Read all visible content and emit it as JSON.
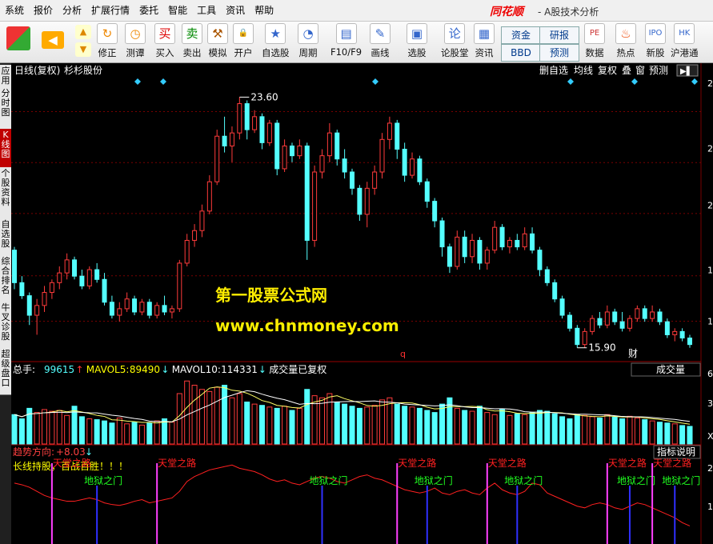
{
  "menu": [
    "系统",
    "报价",
    "分析",
    "扩展行情",
    "委托",
    "智能",
    "工具",
    "资讯",
    "帮助"
  ],
  "brand": "同花顺",
  "app_title": "- A股技术分析",
  "toolbar": {
    "items": [
      {
        "label": "修正",
        "icon": "refresh-icon",
        "x": 121
      },
      {
        "label": "测谭",
        "icon": "clock-icon",
        "x": 156
      },
      {
        "label": "买入",
        "icon": "buy-icon",
        "x": 193
      },
      {
        "label": "卖出",
        "icon": "sell-icon",
        "x": 227
      },
      {
        "label": "模拟",
        "icon": "gavel-icon",
        "x": 259
      },
      {
        "label": "开户",
        "icon": "lock-icon",
        "x": 291
      },
      {
        "label": "自选股",
        "icon": "star-icon",
        "x": 327
      },
      {
        "label": "周期",
        "icon": "clock-period-icon",
        "x": 372
      },
      {
        "label": "F10/F9",
        "icon": "f10-icon",
        "x": 413
      },
      {
        "label": "画线",
        "icon": "pencil-icon",
        "x": 462
      },
      {
        "label": "选股",
        "icon": "monitor-icon",
        "x": 508
      },
      {
        "label": "论股堂",
        "icon": "forum-icon",
        "x": 551
      },
      {
        "label": "资讯",
        "icon": "news-icon",
        "x": 592
      },
      {
        "label": "数据",
        "icon": "pe-icon",
        "x": 730
      },
      {
        "label": "热点",
        "icon": "fire-icon",
        "x": 769
      },
      {
        "label": "新股",
        "icon": "ipo-icon",
        "x": 806
      },
      {
        "label": "沪港通",
        "icon": "hk-icon",
        "x": 838
      }
    ],
    "boxes": [
      {
        "label": "资金",
        "x": 626,
        "y": 33
      },
      {
        "label": "BBD",
        "x": 626,
        "y": 55
      },
      {
        "label": "研报",
        "x": 674,
        "y": 33
      },
      {
        "label": "预测",
        "x": 674,
        "y": 55
      }
    ]
  },
  "side_tabs": [
    {
      "label": "应用",
      "active": false
    },
    {
      "label": "分时图",
      "active": false
    },
    {
      "label": "K线图",
      "active": true
    },
    {
      "label": "个股资料",
      "active": false
    },
    {
      "label": "自选股",
      "active": false
    },
    {
      "label": "综合排名",
      "active": false
    },
    {
      "label": "牛叉诊股",
      "active": false
    },
    {
      "label": "超级盘口",
      "active": false
    }
  ],
  "kline": {
    "period_label": "日线(复权)",
    "stock_name": "杉杉股份",
    "toolbar_right": [
      "删自选",
      "均线",
      "复权",
      "叠",
      "窗",
      "预测"
    ],
    "high_label": "23.60",
    "low_label": "15.90",
    "watermark_title": "第一股票公式网",
    "watermark_url": "www.chnmoney.com",
    "marker_q": "q",
    "marker_cai": "财",
    "right_axis": [
      "2",
      "2",
      "2",
      "1",
      "1"
    ]
  },
  "volume": {
    "total_label": "总手:",
    "total_value": "99615",
    "ma5_label": "MAVOL5:",
    "ma5_value": "89490",
    "ma10_label": "MAVOL10:",
    "ma10_value": "114331",
    "adj_note": "成交量已复权",
    "dropdown": "成交量",
    "right_axis": [
      "6",
      "3",
      "X"
    ]
  },
  "indicator": {
    "name": "趋势方向:",
    "value": "+8.03",
    "help_button": "指标说明",
    "slogan": "长线持股，百战百胜！！！",
    "heaven_label": "天堂之路",
    "hell_label": "地狱之门",
    "right_axis": [
      "2",
      "1"
    ]
  },
  "colors": {
    "up": "#ff3b3b",
    "down": "#54ffff",
    "bg": "#000000",
    "grid": "#7a0000",
    "accent": "#c00000",
    "label_yellow": "#ffff00",
    "heaven": "#ff2020",
    "hell": "#20ff20"
  },
  "chart_data": {
    "type": "candlestick",
    "title": "杉杉股份",
    "candles": [
      {
        "o": 18.9,
        "h": 19.0,
        "l": 17.7,
        "c": 17.9
      },
      {
        "o": 17.9,
        "h": 18.1,
        "l": 17.4,
        "c": 17.5
      },
      {
        "o": 17.5,
        "h": 17.6,
        "l": 16.6,
        "c": 16.9
      },
      {
        "o": 16.9,
        "h": 17.4,
        "l": 16.3,
        "c": 17.2
      },
      {
        "o": 17.2,
        "h": 17.8,
        "l": 17.0,
        "c": 17.6
      },
      {
        "o": 17.6,
        "h": 18.0,
        "l": 17.4,
        "c": 17.9
      },
      {
        "o": 17.9,
        "h": 18.4,
        "l": 17.7,
        "c": 18.2
      },
      {
        "o": 18.2,
        "h": 18.8,
        "l": 18.0,
        "c": 18.6
      },
      {
        "o": 18.6,
        "h": 18.7,
        "l": 18.0,
        "c": 18.1
      },
      {
        "o": 18.1,
        "h": 18.3,
        "l": 17.7,
        "c": 17.8
      },
      {
        "o": 17.8,
        "h": 18.4,
        "l": 17.7,
        "c": 18.3
      },
      {
        "o": 18.3,
        "h": 18.5,
        "l": 17.9,
        "c": 18.0
      },
      {
        "o": 18.0,
        "h": 18.2,
        "l": 17.2,
        "c": 17.3
      },
      {
        "o": 17.3,
        "h": 17.5,
        "l": 16.8,
        "c": 16.9
      },
      {
        "o": 16.9,
        "h": 17.3,
        "l": 16.7,
        "c": 17.1
      },
      {
        "o": 17.1,
        "h": 17.6,
        "l": 17.0,
        "c": 17.4
      },
      {
        "o": 17.4,
        "h": 17.5,
        "l": 16.9,
        "c": 17.0
      },
      {
        "o": 17.0,
        "h": 17.4,
        "l": 16.9,
        "c": 17.3
      },
      {
        "o": 17.3,
        "h": 17.4,
        "l": 16.8,
        "c": 16.9
      },
      {
        "o": 16.9,
        "h": 17.3,
        "l": 16.8,
        "c": 17.2
      },
      {
        "o": 17.2,
        "h": 17.5,
        "l": 16.9,
        "c": 17.0
      },
      {
        "o": 17.0,
        "h": 17.2,
        "l": 16.8,
        "c": 17.1
      },
      {
        "o": 17.1,
        "h": 18.6,
        "l": 17.0,
        "c": 18.5
      },
      {
        "o": 18.5,
        "h": 19.4,
        "l": 18.4,
        "c": 19.2
      },
      {
        "o": 19.2,
        "h": 19.7,
        "l": 19.0,
        "c": 19.5
      },
      {
        "o": 19.5,
        "h": 20.3,
        "l": 19.3,
        "c": 20.1
      },
      {
        "o": 20.1,
        "h": 21.2,
        "l": 20.0,
        "c": 21.0
      },
      {
        "o": 21.0,
        "h": 22.6,
        "l": 20.9,
        "c": 22.4
      },
      {
        "o": 22.4,
        "h": 23.0,
        "l": 21.9,
        "c": 22.1
      },
      {
        "o": 22.1,
        "h": 22.7,
        "l": 21.6,
        "c": 22.5
      },
      {
        "o": 22.5,
        "h": 23.6,
        "l": 22.3,
        "c": 23.4
      },
      {
        "o": 23.4,
        "h": 23.5,
        "l": 22.3,
        "c": 22.6
      },
      {
        "o": 22.6,
        "h": 23.2,
        "l": 22.5,
        "c": 23.0
      },
      {
        "o": 23.0,
        "h": 23.1,
        "l": 22.0,
        "c": 22.2
      },
      {
        "o": 22.2,
        "h": 22.9,
        "l": 22.1,
        "c": 22.8
      },
      {
        "o": 22.8,
        "h": 22.9,
        "l": 21.2,
        "c": 21.4
      },
      {
        "o": 21.4,
        "h": 22.3,
        "l": 21.3,
        "c": 22.1
      },
      {
        "o": 22.1,
        "h": 22.2,
        "l": 21.6,
        "c": 21.8
      },
      {
        "o": 21.8,
        "h": 22.3,
        "l": 21.7,
        "c": 22.1
      },
      {
        "o": 22.1,
        "h": 22.2,
        "l": 18.6,
        "c": 19.2
      },
      {
        "o": 19.2,
        "h": 21.5,
        "l": 19.0,
        "c": 21.3
      },
      {
        "o": 21.3,
        "h": 22.0,
        "l": 21.1,
        "c": 21.8
      },
      {
        "o": 21.8,
        "h": 22.8,
        "l": 21.6,
        "c": 22.5
      },
      {
        "o": 22.5,
        "h": 22.6,
        "l": 21.5,
        "c": 21.7
      },
      {
        "o": 21.7,
        "h": 22.0,
        "l": 21.1,
        "c": 21.3
      },
      {
        "o": 21.3,
        "h": 21.4,
        "l": 20.6,
        "c": 20.8
      },
      {
        "o": 20.8,
        "h": 20.9,
        "l": 19.8,
        "c": 20.0
      },
      {
        "o": 20.0,
        "h": 21.0,
        "l": 19.6,
        "c": 20.8
      },
      {
        "o": 20.8,
        "h": 21.5,
        "l": 20.6,
        "c": 21.3
      },
      {
        "o": 21.3,
        "h": 22.5,
        "l": 21.1,
        "c": 22.3
      },
      {
        "o": 22.3,
        "h": 23.0,
        "l": 22.0,
        "c": 22.8
      },
      {
        "o": 22.8,
        "h": 22.9,
        "l": 21.7,
        "c": 22.0
      },
      {
        "o": 22.0,
        "h": 22.2,
        "l": 21.0,
        "c": 21.2
      },
      {
        "o": 21.2,
        "h": 21.9,
        "l": 21.1,
        "c": 21.7
      },
      {
        "o": 21.7,
        "h": 21.8,
        "l": 20.9,
        "c": 21.0
      },
      {
        "o": 21.0,
        "h": 21.1,
        "l": 20.2,
        "c": 20.4
      },
      {
        "o": 20.4,
        "h": 20.5,
        "l": 19.6,
        "c": 19.8
      },
      {
        "o": 19.8,
        "h": 19.9,
        "l": 18.7,
        "c": 19.0
      },
      {
        "o": 19.0,
        "h": 19.1,
        "l": 18.2,
        "c": 18.4
      },
      {
        "o": 18.4,
        "h": 19.5,
        "l": 18.3,
        "c": 19.3
      },
      {
        "o": 19.3,
        "h": 19.5,
        "l": 18.5,
        "c": 18.7
      },
      {
        "o": 18.7,
        "h": 19.4,
        "l": 18.5,
        "c": 19.2
      },
      {
        "o": 19.2,
        "h": 19.3,
        "l": 18.3,
        "c": 18.5
      },
      {
        "o": 18.5,
        "h": 19.0,
        "l": 18.3,
        "c": 18.9
      },
      {
        "o": 18.9,
        "h": 19.8,
        "l": 18.8,
        "c": 19.6
      },
      {
        "o": 19.6,
        "h": 19.7,
        "l": 18.9,
        "c": 19.0
      },
      {
        "o": 19.0,
        "h": 19.3,
        "l": 18.8,
        "c": 19.2
      },
      {
        "o": 19.2,
        "h": 19.4,
        "l": 18.9,
        "c": 19.0
      },
      {
        "o": 19.0,
        "h": 19.6,
        "l": 18.9,
        "c": 19.4
      },
      {
        "o": 19.4,
        "h": 19.6,
        "l": 18.8,
        "c": 18.9
      },
      {
        "o": 18.9,
        "h": 19.0,
        "l": 18.1,
        "c": 18.3
      },
      {
        "o": 18.3,
        "h": 18.4,
        "l": 17.8,
        "c": 17.9
      },
      {
        "o": 17.9,
        "h": 18.0,
        "l": 17.3,
        "c": 17.4
      },
      {
        "o": 17.4,
        "h": 17.5,
        "l": 16.8,
        "c": 16.9
      },
      {
        "o": 16.9,
        "h": 17.0,
        "l": 16.4,
        "c": 16.5
      },
      {
        "o": 16.5,
        "h": 16.6,
        "l": 15.9,
        "c": 16.0
      },
      {
        "o": 16.0,
        "h": 16.5,
        "l": 15.9,
        "c": 16.4
      },
      {
        "o": 16.4,
        "h": 16.9,
        "l": 16.3,
        "c": 16.8
      },
      {
        "o": 16.8,
        "h": 17.0,
        "l": 16.5,
        "c": 16.6
      },
      {
        "o": 16.6,
        "h": 17.2,
        "l": 16.5,
        "c": 17.0
      },
      {
        "o": 17.0,
        "h": 17.1,
        "l": 16.6,
        "c": 16.7
      },
      {
        "o": 16.7,
        "h": 17.0,
        "l": 16.4,
        "c": 16.5
      },
      {
        "o": 16.5,
        "h": 16.9,
        "l": 16.4,
        "c": 16.8
      },
      {
        "o": 16.8,
        "h": 17.2,
        "l": 16.7,
        "c": 17.1
      },
      {
        "o": 17.1,
        "h": 17.2,
        "l": 16.7,
        "c": 16.8
      },
      {
        "o": 16.8,
        "h": 17.2,
        "l": 16.7,
        "c": 17.0
      },
      {
        "o": 17.0,
        "h": 17.1,
        "l": 16.6,
        "c": 16.7
      },
      {
        "o": 16.7,
        "h": 16.8,
        "l": 16.2,
        "c": 16.3
      },
      {
        "o": 16.3,
        "h": 16.5,
        "l": 16.1,
        "c": 16.4
      },
      {
        "o": 16.4,
        "h": 16.5,
        "l": 16.1,
        "c": 16.2
      },
      {
        "o": 16.2,
        "h": 16.3,
        "l": 15.9,
        "c": 16.0
      }
    ],
    "volume": [
      70,
      60,
      85,
      75,
      82,
      78,
      80,
      68,
      90,
      65,
      60,
      58,
      55,
      50,
      62,
      48,
      52,
      45,
      50,
      55,
      60,
      52,
      120,
      150,
      140,
      130,
      125,
      135,
      140,
      110,
      120,
      100,
      95,
      92,
      88,
      85,
      90,
      80,
      85,
      130,
      115,
      110,
      120,
      100,
      95,
      90,
      85,
      88,
      92,
      105,
      110,
      95,
      90,
      88,
      85,
      80,
      75,
      95,
      110,
      85,
      80,
      78,
      90,
      75,
      70,
      82,
      68,
      72,
      70,
      75,
      80,
      78,
      72,
      65,
      60,
      70,
      68,
      65,
      62,
      70,
      64,
      60,
      66,
      62,
      58,
      55,
      52,
      50,
      48,
      44,
      42
    ],
    "trend_line": [
      70,
      68,
      65,
      60,
      55,
      52,
      50,
      48,
      48,
      50,
      52,
      50,
      46,
      44,
      43,
      45,
      48,
      50,
      46,
      48,
      50,
      52,
      60,
      72,
      78,
      82,
      86,
      88,
      90,
      92,
      88,
      86,
      84,
      80,
      75,
      72,
      74,
      70,
      68,
      72,
      76,
      78,
      76,
      72,
      70,
      74,
      78,
      80,
      76,
      74,
      70,
      66,
      62,
      60,
      58,
      60,
      64,
      58,
      56,
      60,
      62,
      58,
      56,
      64,
      70,
      62,
      58,
      56,
      60,
      70,
      68,
      58,
      54,
      50,
      46,
      42,
      40,
      44,
      46,
      44,
      40,
      38,
      42,
      46,
      44,
      40,
      36,
      32,
      28,
      22,
      18
    ],
    "signal_events": [
      {
        "index": 5,
        "type": "heaven"
      },
      {
        "index": 11,
        "type": "hell"
      },
      {
        "index": 19,
        "type": "heaven"
      },
      {
        "index": 41,
        "type": "hell"
      },
      {
        "index": 51,
        "type": "heaven"
      },
      {
        "index": 55,
        "type": "hell"
      },
      {
        "index": 63,
        "type": "heaven"
      },
      {
        "index": 67,
        "type": "hell"
      },
      {
        "index": 79,
        "type": "heaven"
      },
      {
        "index": 82,
        "type": "hell"
      },
      {
        "index": 85,
        "type": "heaven"
      },
      {
        "index": 88,
        "type": "hell"
      }
    ],
    "ma_lines": true,
    "ylim": [
      15.5,
      24.2
    ],
    "volume_ylim": [
      0,
      160
    ]
  }
}
